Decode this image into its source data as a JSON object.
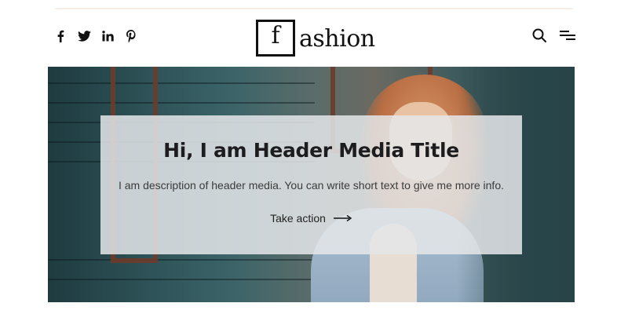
{
  "header": {
    "social": [
      {
        "icon": "facebook-icon",
        "glyph": "f"
      },
      {
        "icon": "twitter-icon"
      },
      {
        "icon": "linkedin-icon",
        "glyph": "in"
      },
      {
        "icon": "pinterest-icon"
      }
    ],
    "logo": {
      "letter": "f",
      "rest": "ashion"
    },
    "tools": [
      {
        "icon": "search-icon"
      },
      {
        "icon": "menu-icon"
      }
    ]
  },
  "hero": {
    "title": "Hi, I am Header Media Title",
    "description": "I am description of header media. You can write short text to give me more info.",
    "action_label": "Take action",
    "action_icon": "arrow-right-icon"
  }
}
